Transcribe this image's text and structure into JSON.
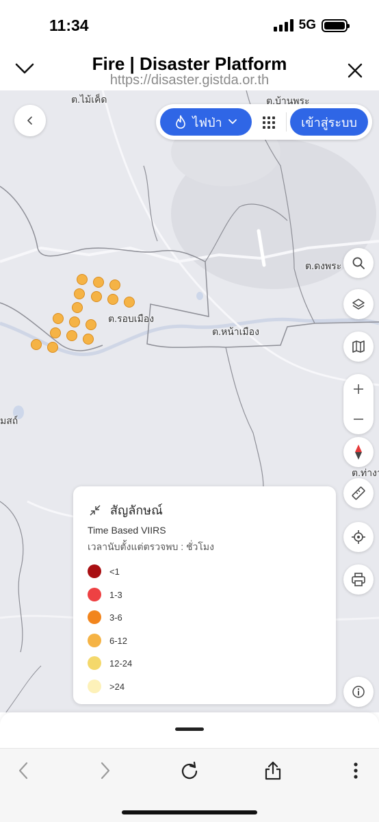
{
  "status": {
    "time": "11:34",
    "network": "5G"
  },
  "browser": {
    "title": "Fire | Disaster Platform",
    "url": "https://disaster.gistda.or.th"
  },
  "topbar": {
    "layer_label": "ไฟป่า",
    "login_label": "เข้าสู่ระบบ"
  },
  "map": {
    "places": [
      {
        "name": "ต.ไม้เค็ด"
      },
      {
        "name": "ต.บ้านพระ"
      },
      {
        "name": "ต.ดงพระ"
      },
      {
        "name": "ต.รอบเมือง"
      },
      {
        "name": "ต.หน้าเมือง"
      },
      {
        "name": "มสถ์"
      },
      {
        "name": "ต.ท่างา"
      }
    ],
    "hotspot_color": "#f5b345"
  },
  "legend": {
    "title": "สัญลักษณ์",
    "subtitle": "Time Based VIIRS",
    "caption": "เวลานับตั้งแต่ตรวจพบ : ชั่วโมง",
    "items": [
      {
        "label": "<1",
        "color": "#a90f12"
      },
      {
        "label": "1-3",
        "color": "#ee4143"
      },
      {
        "label": "3-6",
        "color": "#f2851d"
      },
      {
        "label": "6-12",
        "color": "#f5b345"
      },
      {
        "label": "12-24",
        "color": "#f4d86b"
      },
      {
        "label": ">24",
        "color": "#fdf1b9"
      }
    ]
  },
  "icons": {
    "header_left": "chevron-down-icon",
    "header_right": "close-icon",
    "map_tools": [
      "search-icon",
      "layers-icon",
      "map-icon",
      "zoom-in-icon",
      "zoom-out-icon",
      "compass-icon",
      "ruler-icon",
      "locate-icon",
      "print-icon",
      "info-icon"
    ],
    "toolbar": [
      "back-icon",
      "forward-icon",
      "reload-icon",
      "share-icon",
      "more-icon"
    ]
  }
}
